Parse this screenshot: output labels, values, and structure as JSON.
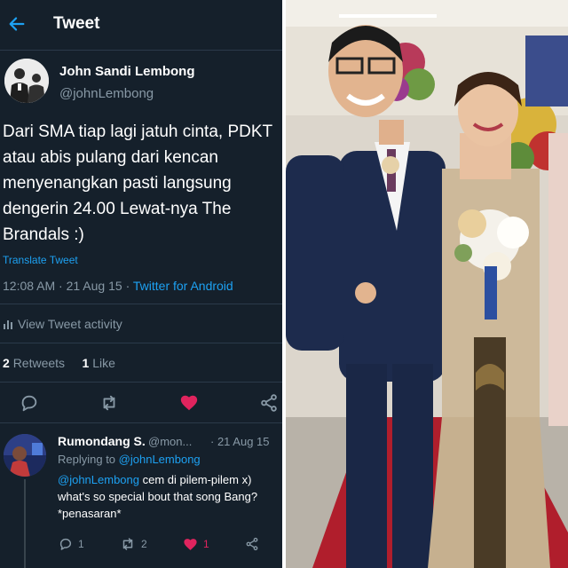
{
  "header": {
    "title": "Tweet"
  },
  "tweet": {
    "author_name": "John Sandi Lembong",
    "author_handle": "@johnLembong",
    "text": "Dari SMA tiap lagi jatuh cinta, PDKT atau abis pulang dari kencan menyenangkan pasti langsung dengerin 24.00 Lewat-nya The Brandals :)",
    "translate": "Translate Tweet",
    "time": "12:08 AM",
    "date": "21 Aug 15",
    "source": "Twitter for Android",
    "activity": "View Tweet activity",
    "retweets_count": "2",
    "retweets_label": "Retweets",
    "likes_count": "1",
    "likes_label": "Like"
  },
  "reply": {
    "author_name": "Rumondang S.",
    "author_handle": "@mon...",
    "date": "· 21 Aug 15",
    "replying_label": "Replying to",
    "replying_to": "@johnLembong",
    "mention": "@johnLembong",
    "text": "cem di pilem-pilem x) what's so special bout that song Bang? *penasaran*",
    "reply_count": "1",
    "retweet_count": "2",
    "like_count": "1"
  },
  "icons": {
    "back": "arrow-left-icon",
    "reply": "speech-bubble-icon",
    "retweet": "retweet-icon",
    "like": "heart-icon",
    "share": "share-icon",
    "activity": "bar-chart-icon"
  },
  "colors": {
    "background": "#15202b",
    "accent": "#1da1f2",
    "like": "#e0245e",
    "muted": "#8899a6"
  }
}
